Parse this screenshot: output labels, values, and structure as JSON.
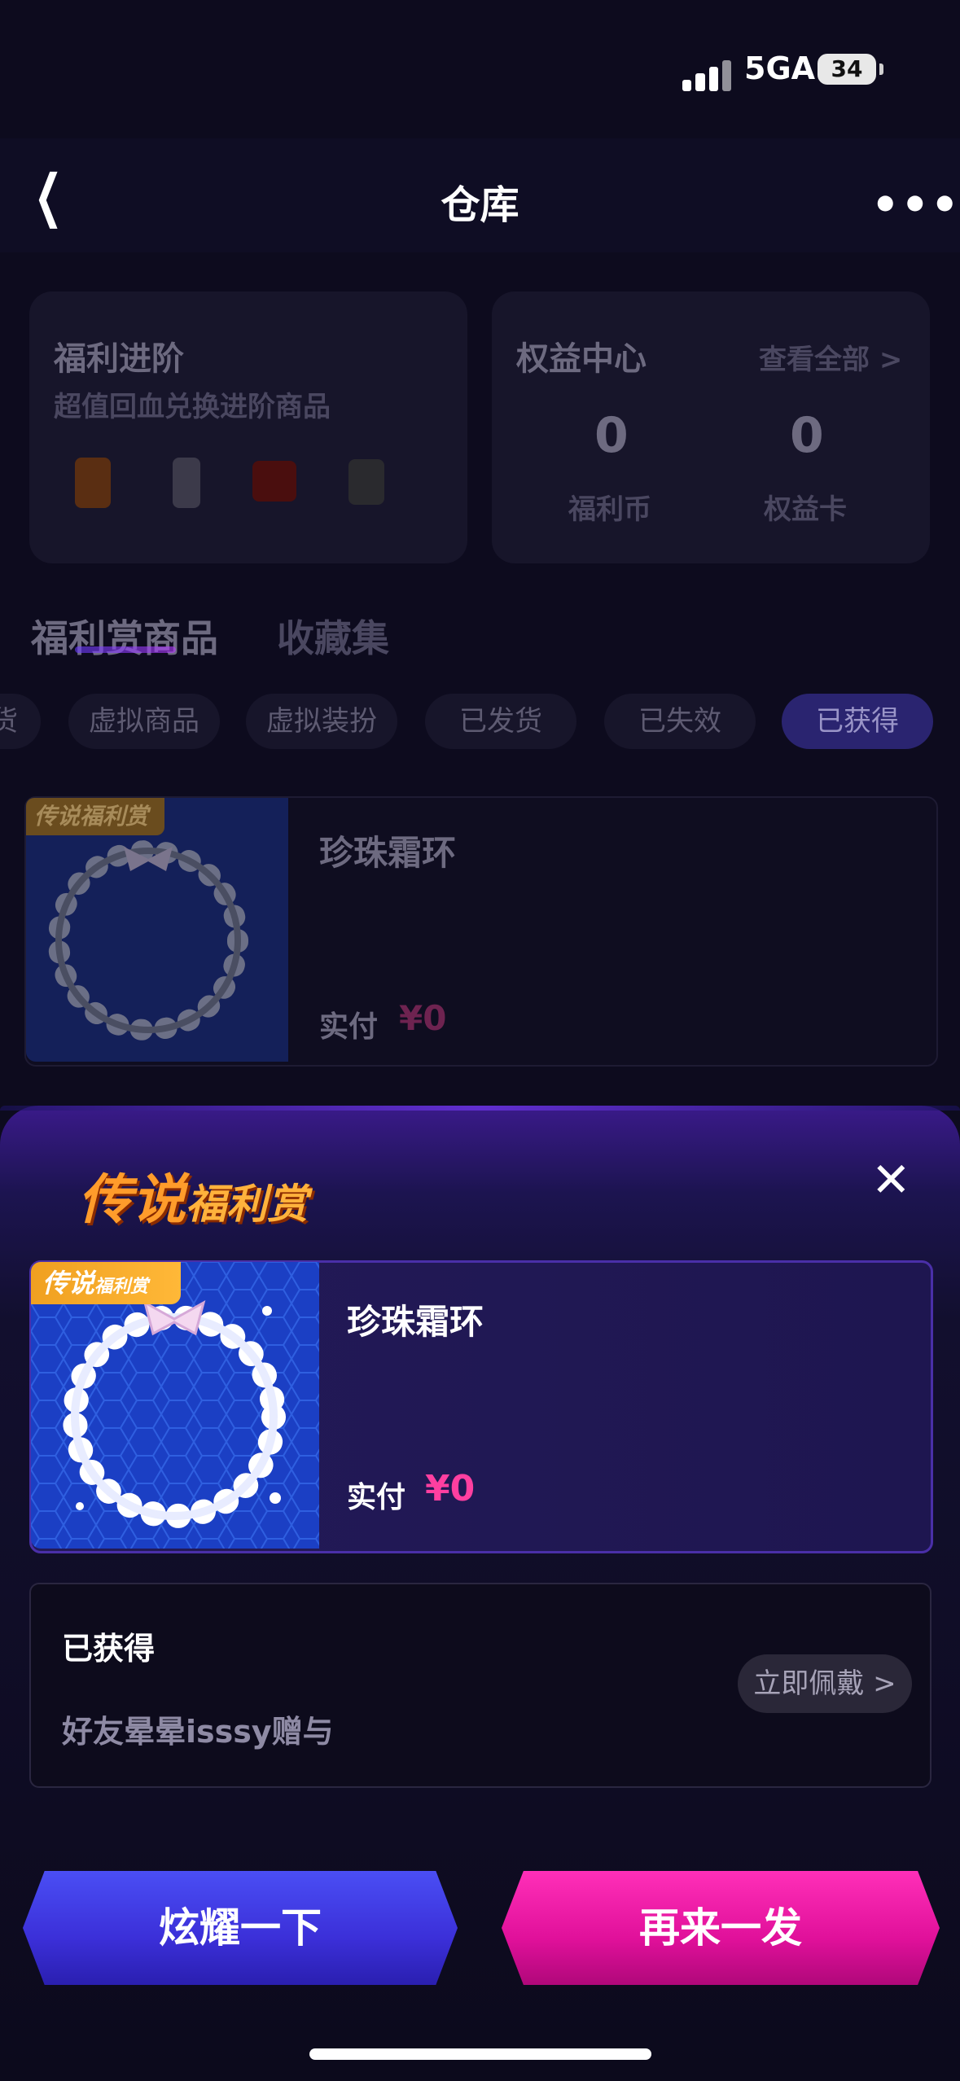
{
  "status_bar": {
    "network": "5GA",
    "battery": "34"
  },
  "nav": {
    "title": "仓库"
  },
  "background": {
    "welfare_card": {
      "title": "福利进阶",
      "subtitle": "超值回血兑换进阶商品"
    },
    "rights_card": {
      "title": "权益中心",
      "view_all": "查看全部 >",
      "coins_value": "0",
      "coins_label": "福利币",
      "cards_value": "0",
      "cards_label": "权益卡"
    },
    "tabs": [
      "福利赏商品",
      "收藏集"
    ],
    "chips": [
      "货",
      "虚拟商品",
      "虚拟装扮",
      "已发货",
      "已失效",
      "已获得"
    ],
    "list_item": {
      "name": "珍珠霜环",
      "paid_label": "实付",
      "price": "¥0",
      "tag": "传说福利赏"
    }
  },
  "sheet": {
    "logo_main": "传说",
    "logo_sub": "福利赏",
    "prize": {
      "tag_main": "传说",
      "tag_sub": "福利赏",
      "name": "珍珠霜环",
      "paid_label": "实付",
      "price": "¥0"
    },
    "info": {
      "status": "已获得",
      "from": "好友晕晕isssy赠与",
      "wear_button": "立即佩戴 >"
    },
    "buttons": {
      "show_off": "炫耀一下",
      "again": "再来一发"
    }
  },
  "colors": {
    "accent_pink": "#ff3fa0",
    "accent_blue": "#3b2fd8",
    "legend_orange": "#ff9c2b"
  }
}
